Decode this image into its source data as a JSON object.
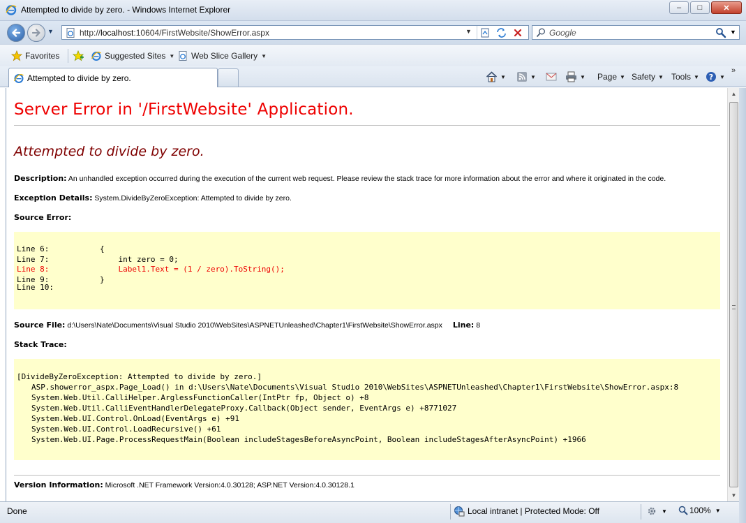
{
  "window": {
    "title": "Attempted to divide by zero. - Windows Internet Explorer",
    "minimize_glyph": "–",
    "maximize_glyph": "□",
    "close_glyph": "✕"
  },
  "address": {
    "url_prefix": "http://",
    "url_host": "localhost",
    "url_rest": ":10604/FirstWebsite/ShowError.aspx"
  },
  "search": {
    "placeholder": "Google"
  },
  "favorites": {
    "favorites_label": "Favorites",
    "suggested_label": "Suggested Sites",
    "webslice_label": "Web Slice Gallery"
  },
  "tab": {
    "label": "Attempted to divide by zero."
  },
  "commandbar": {
    "page_label": "Page",
    "safety_label": "Safety",
    "tools_label": "Tools"
  },
  "error_page": {
    "heading": "Server Error in '/FirstWebsite' Application.",
    "subheading": "Attempted to divide by zero.",
    "description_label": "Description:",
    "description_text": "An unhandled exception occurred during the execution of the current web request. Please review the stack trace for more information about the error and where it originated in the code.",
    "exception_label": "Exception Details:",
    "exception_text": "System.DivideByZeroException: Attempted to divide by zero.",
    "source_error_label": "Source Error:",
    "source_lines": [
      {
        "ln": "Line 6:",
        "code": "{"
      },
      {
        "ln": "Line 7:",
        "code": "    int zero = 0;"
      },
      {
        "ln": "Line 8:",
        "code": "    Label1.Text = (1 / zero).ToString();"
      },
      {
        "ln": "Line 9:",
        "code": "}"
      },
      {
        "ln": "Line 10:",
        "code": ""
      }
    ],
    "source_file_label": "Source File:",
    "source_file_path": "d:\\Users\\Nate\\Documents\\Visual Studio 2010\\WebSites\\ASPNETUnleashed\\Chapter1\\FirstWebsite\\ShowError.aspx",
    "line_label": "Line:",
    "line_value": "8",
    "stack_trace_label": "Stack Trace:",
    "stack_trace": [
      "[DivideByZeroException: Attempted to divide by zero.]",
      "ASP.showerror_aspx.Page_Load() in d:\\Users\\Nate\\Documents\\Visual Studio 2010\\WebSites\\ASPNETUnleashed\\Chapter1\\FirstWebsite\\ShowError.aspx:8",
      "System.Web.Util.CalliHelper.ArglessFunctionCaller(IntPtr fp, Object o) +8",
      "System.Web.Util.CalliEventHandlerDelegateProxy.Callback(Object sender, EventArgs e) +8771027",
      "System.Web.UI.Control.OnLoad(EventArgs e) +91",
      "System.Web.UI.Control.LoadRecursive() +61",
      "System.Web.UI.Page.ProcessRequestMain(Boolean includeStagesBeforeAsyncPoint, Boolean includeStagesAfterAsyncPoint) +1966"
    ],
    "version_label": "Version Information:",
    "version_text": "Microsoft .NET Framework Version:4.0.30128; ASP.NET Version:4.0.30128.1"
  },
  "statusbar": {
    "status": "Done",
    "zone": "Local intranet | Protected Mode: Off",
    "zoom": "100%"
  },
  "colors": {
    "heading_red": "#e00000",
    "subheading_maroon": "#7f0000",
    "code_background": "#ffffcc",
    "chrome_blue": "#d3deec"
  }
}
